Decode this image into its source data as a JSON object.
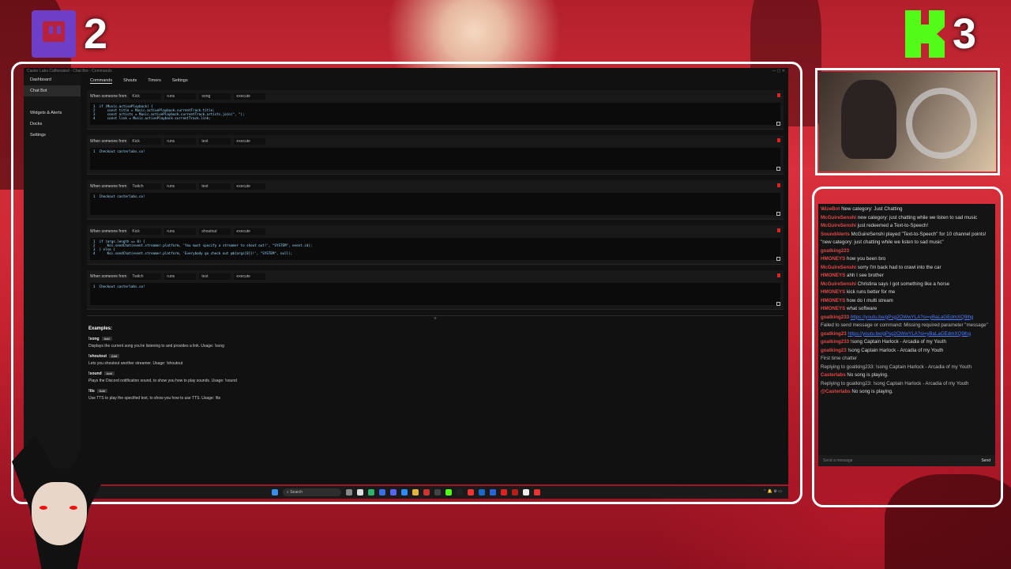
{
  "overlay": {
    "twitch_count": "2",
    "kick_count": "3"
  },
  "app": {
    "title": "Caster Labs Caffeinated - Chat Bot - Commands"
  },
  "sidebar": {
    "items": [
      {
        "label": "Dashboard"
      },
      {
        "label": "Chat Bot"
      },
      {
        "label": "Widgets & Alerts"
      },
      {
        "label": "Docks"
      },
      {
        "label": "Settings"
      }
    ]
  },
  "tabs": [
    {
      "label": "Commands"
    },
    {
      "label": "Shouts"
    },
    {
      "label": "Timers"
    },
    {
      "label": "Settings"
    }
  ],
  "commands": [
    {
      "prefix": "When someone from",
      "platform": "Kick",
      "mode": "runs",
      "trigger": "song",
      "action": "execute",
      "code": [
        "1  if (Music.activePlayback) {",
        "2      const title = Music.activePlayback.currentTrack.title;",
        "3      const artists = Music.activePlayback.currentTrack.artists.join(\", \");",
        "4      const link = Music.activePlayback.currentTrack.link;"
      ]
    },
    {
      "prefix": "When someone from",
      "platform": "Kick",
      "mode": "runs",
      "trigger": "test",
      "action": "execute",
      "code": [
        "1  Checkout casterlabs.co!"
      ]
    },
    {
      "prefix": "When someone from",
      "platform": "Twitch",
      "mode": "runs",
      "trigger": "test",
      "action": "execute",
      "code": [
        "1  Checkout casterlabs.co!"
      ]
    },
    {
      "prefix": "When someone from",
      "platform": "Kick",
      "mode": "runs",
      "trigger": "shoutout",
      "action": "execute",
      "code": [
        "1  if (args.length == 0) {",
        "2      Koi.sendChat(event.streamer.platform, 'You must specify a streamer to shout out!', \"SYSTEM\", event.id);",
        "3  } else {",
        "4      Koi.sendChat(event.streamer.platform, 'Everybody go check out @${args[0]}!', \"SYSTEM\", null);"
      ]
    },
    {
      "prefix": "When someone from",
      "platform": "Twitch",
      "mode": "runs",
      "trigger": "test",
      "action": "execute",
      "code": [
        "1  Checkout casterlabs.co!"
      ]
    }
  ],
  "add_symbol": "+",
  "examples": {
    "heading": "Examples:",
    "add_label": "Add",
    "items": [
      {
        "name": "!song",
        "desc": "Displays the current song you're listening to and provides a link. Usage: !song"
      },
      {
        "name": "!shoutout",
        "desc": "Lets you shoutout another streamer. Usage: !shoutout"
      },
      {
        "name": "!sound",
        "desc": "Plays the Discord notification sound, to show you how to play sounds. Usage: !sound"
      },
      {
        "name": "!tts",
        "desc": "Use TTS to play the specified text, to show you how to use TTS. Usage: !tts"
      }
    ]
  },
  "taskbar": {
    "search": "Search"
  },
  "chat": {
    "messages": [
      {
        "user": "WizeBot",
        "text": "New category: Just Chatting"
      },
      {
        "user": "McGuireSenshi",
        "text": "new category: just chatting while we listen to sad music"
      },
      {
        "user": "McGuireSenshi",
        "text": "just redeemed a Text-to-Speech!"
      },
      {
        "user": "SoundAlerts",
        "text": "McGuireSenshi played \"Text-to-Speech\" for 10 channel points! \"new category: just chatting while we listen to sad music\""
      },
      {
        "user": "goatking223",
        "text": ""
      },
      {
        "user": "HMONEYS",
        "text": "how you been bro"
      },
      {
        "user": "McGuireSenshi",
        "text": "sorry I'm back had to crawl into the car"
      },
      {
        "user": "HMONEYS",
        "text": "ahh I see brother"
      },
      {
        "user": "McGuireSenshi",
        "text": "Christina says I got something like a horse"
      },
      {
        "user": "HMONEYS",
        "text": "kick runs better for me"
      },
      {
        "user": "HMONEYS",
        "text": "how do I multi stream"
      },
      {
        "user": "HMONEYS",
        "text": "what software"
      },
      {
        "user": "goatking233",
        "link": "https://youtu.be/gPsg2OWwYLA?si=yBaLaGEdmXQ9lhg"
      },
      {
        "user": "",
        "text": "Failed to send message or command: Missing required parameter \"message\""
      },
      {
        "user": "goatking23",
        "link": "https://youtu.be/gPsg2OWwYLA?si=yBaLaGEdmXQ9lhg"
      },
      {
        "user": "goatking233",
        "text": "!song Captain Harlock - Arcadia of my Youth"
      },
      {
        "user": "goatking23",
        "text": "!song Captain Harlock - Arcadia of my Youth"
      },
      {
        "user": "",
        "text": "First time chatter"
      },
      {
        "user": "",
        "text": "Replying to goatking233: !song Captain Harlock - Arcadia of my Youth"
      },
      {
        "user": "Casterlabs",
        "text": "No song is playing."
      },
      {
        "user": "",
        "text": "Replying to goatking23: !song Captain Harlock - Arcadia of my Youth"
      },
      {
        "user": "@Casterlabs",
        "text": "No song is playing."
      }
    ],
    "placeholder": "Send a message",
    "send": "Send"
  }
}
